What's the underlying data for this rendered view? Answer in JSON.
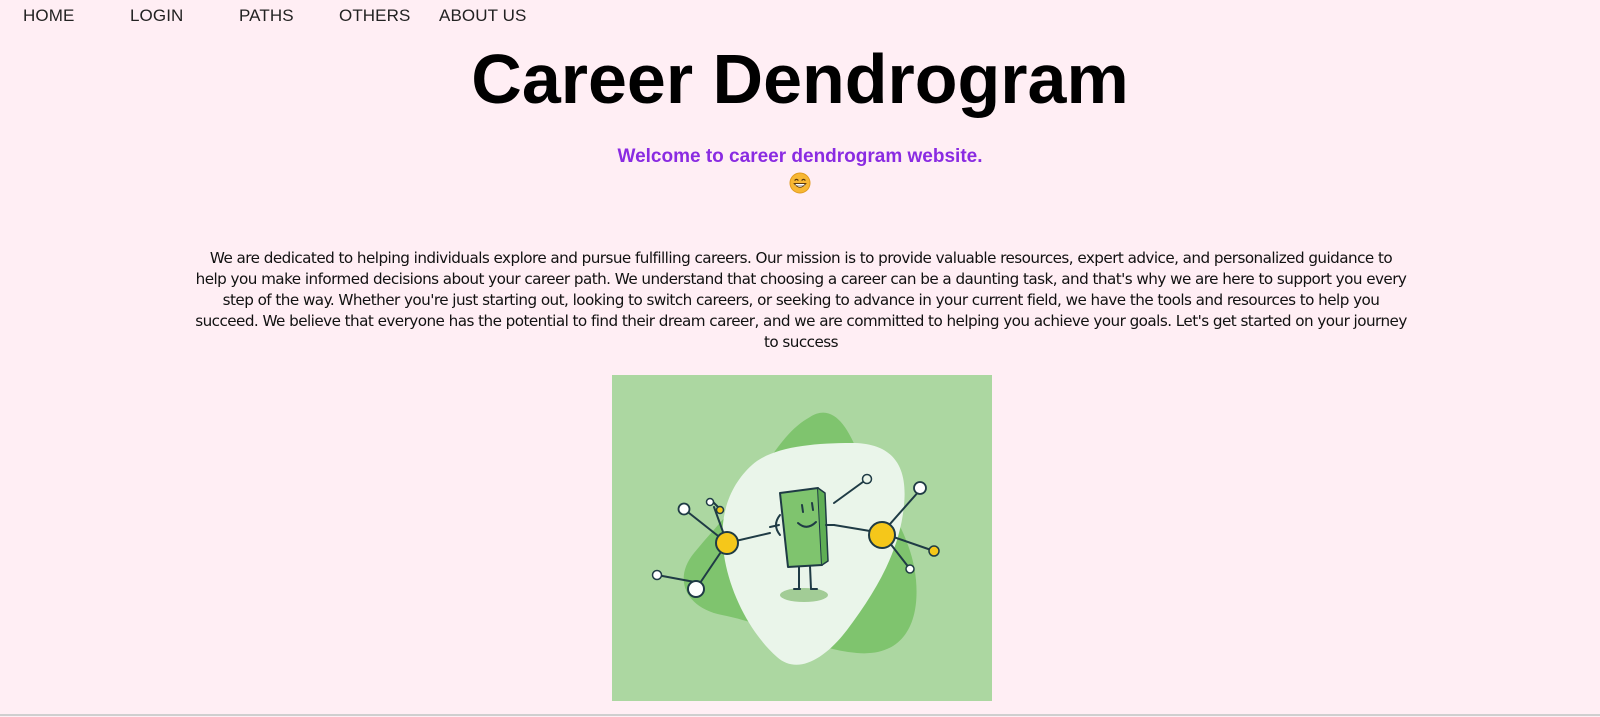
{
  "nav": {
    "items": [
      {
        "label": "HOME"
      },
      {
        "label": "LOGIN"
      },
      {
        "label": "PATHS"
      },
      {
        "label": "OTHERS"
      },
      {
        "label": "ABOUT US"
      }
    ]
  },
  "header": {
    "title": "Career Dendrogram",
    "welcome": "Welcome to career dendrogram website.",
    "emoji": "grinning-face-icon"
  },
  "main": {
    "intro": "We are dedicated to helping individuals explore and pursue fulfilling careers. Our mission is to provide valuable resources, expert advice, and personalized guidance to help you make informed decisions about your career path. We understand that choosing a career can be a daunting task, and that's why we are here to support you every step of the way. Whether you're just starting out, looking to switch careers, or seeking to advance in your current field, we have the tools and resources to help you succeed. We believe that everyone has the potential to find their dream career, and we are committed to helping you achieve your goals. Let's get started on your journey to success",
    "illustration": "career-network-illustration"
  },
  "colors": {
    "background": "#ffeef4",
    "welcome_text": "#8a2be2",
    "illustration_bg": "#acd7a1",
    "blob_dark": "#7fc46e",
    "blob_light": "#eaf5ea",
    "node_yellow": "#f5c71a",
    "stroke": "#1f3b45"
  }
}
